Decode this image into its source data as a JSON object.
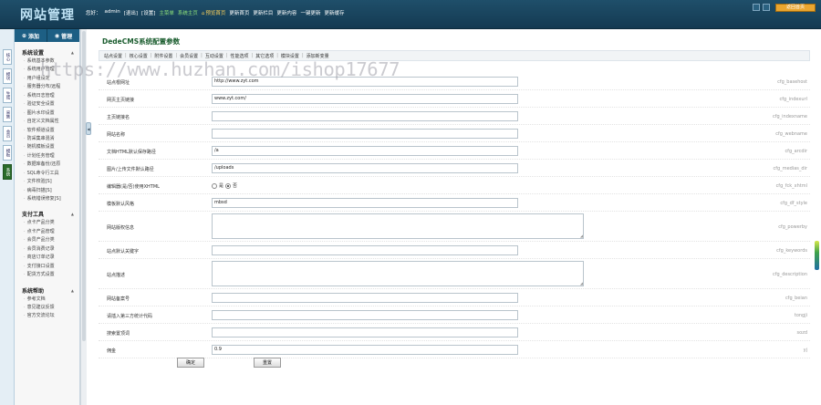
{
  "header": {
    "logo": "网站管理",
    "links": [
      {
        "label": "您好：",
        "cls": ""
      },
      {
        "label": "admin",
        "cls": ""
      },
      {
        "label": "[退出]",
        "cls": ""
      },
      {
        "label": "[设置]",
        "cls": ""
      },
      {
        "label": "主菜单",
        "cls": "hl"
      },
      {
        "label": "系统主页",
        "cls": "hl"
      },
      {
        "label": "预览首页",
        "cls": "home"
      },
      {
        "label": "更新首页",
        "cls": ""
      },
      {
        "label": "更新栏目",
        "cls": ""
      },
      {
        "label": "更新内容",
        "cls": ""
      },
      {
        "label": "一键更新",
        "cls": ""
      },
      {
        "label": "更新缓存",
        "cls": ""
      }
    ],
    "site_button": "返回首页"
  },
  "left_strip": {
    "tabs": [
      "核心",
      "模块",
      "生成",
      "采集",
      "会员",
      "模板",
      "系统"
    ],
    "active": "系统"
  },
  "sidebar": {
    "add_label": "添加",
    "manage_label": "管理",
    "groups": [
      {
        "title": "系统设置",
        "items": [
          "系统基本参数",
          "系统用户管理",
          "用户组设定",
          "服务器分布/远程",
          "系统日志管理",
          "验证安全设置",
          "图片水印设置",
          "自定义文档属性",
          "软件频道设置",
          "防采集串混淆",
          "随机模板设置",
          "计划任务管理",
          "数据库备份/还原",
          "SQL命令行工具",
          "文件校验[S]",
          "病毒扫描[S]",
          "系统错误修复[S]"
        ]
      },
      {
        "title": "支付工具",
        "items": [
          "点卡产品分类",
          "点卡产品管理",
          "会员产品分类",
          "会员消费记录",
          "商店订单记录",
          "支付接口设置",
          "配货方式设置"
        ]
      },
      {
        "title": "系统帮助",
        "items": [
          "参考文档",
          "意见建议反馈",
          "官方交流论坛"
        ]
      }
    ]
  },
  "content": {
    "title": "DedeCMS系统配置参数",
    "tabs": [
      "站点设置",
      "核心设置",
      "附件设置",
      "会员设置",
      "互动设置",
      "性能选项",
      "其它选项",
      "模块设置",
      "添加新变量"
    ],
    "fields": [
      {
        "label": "站点根网址",
        "type": "text",
        "value": "http://www.zyt.com",
        "var": "cfg_basehost"
      },
      {
        "label": "网页主页链接",
        "type": "text",
        "value": "www.zyt.com/",
        "var": "cfg_indexurl"
      },
      {
        "label": "主页链接名",
        "type": "text",
        "value": "",
        "var": "cfg_indexname"
      },
      {
        "label": "网站名称",
        "type": "text",
        "value": "",
        "var": "cfg_webname"
      },
      {
        "label": "文档HTML默认保存路径",
        "type": "text",
        "value": "/a",
        "var": "cfg_arcdir"
      },
      {
        "label": "图片/上传文件默认路径",
        "type": "text",
        "value": "/uploads",
        "var": "cfg_medias_dir"
      },
      {
        "label": "编辑器(是/否)使用XHTML",
        "type": "radio",
        "options": [
          "是",
          "否"
        ],
        "selected": "否",
        "var": "cfg_fck_xhtml"
      },
      {
        "label": "模板默认风格",
        "type": "text",
        "value": "mbsd",
        "var": "cfg_df_style"
      },
      {
        "label": "网站版权信息",
        "type": "textarea",
        "value": "",
        "var": "cfg_powerby"
      },
      {
        "label": "站点默认关键字",
        "type": "text",
        "value": "",
        "var": "cfg_keywords"
      },
      {
        "label": "站点描述",
        "type": "textarea",
        "value": "",
        "var": "cfg_description"
      },
      {
        "label": "网站备案号",
        "type": "text",
        "value": "",
        "var": "cfg_beian"
      },
      {
        "label": "请插入第三方统计代码",
        "type": "text",
        "value": "",
        "var": "tongji"
      },
      {
        "label": "搜索置顶词",
        "type": "text",
        "value": "",
        "var": "sozd"
      },
      {
        "label": "佣金",
        "type": "text",
        "value": "0.9",
        "var": "yj"
      }
    ],
    "submit_label": "确定",
    "reset_label": "重置"
  },
  "watermark": "https://www.huzhan.com/ishop17677"
}
